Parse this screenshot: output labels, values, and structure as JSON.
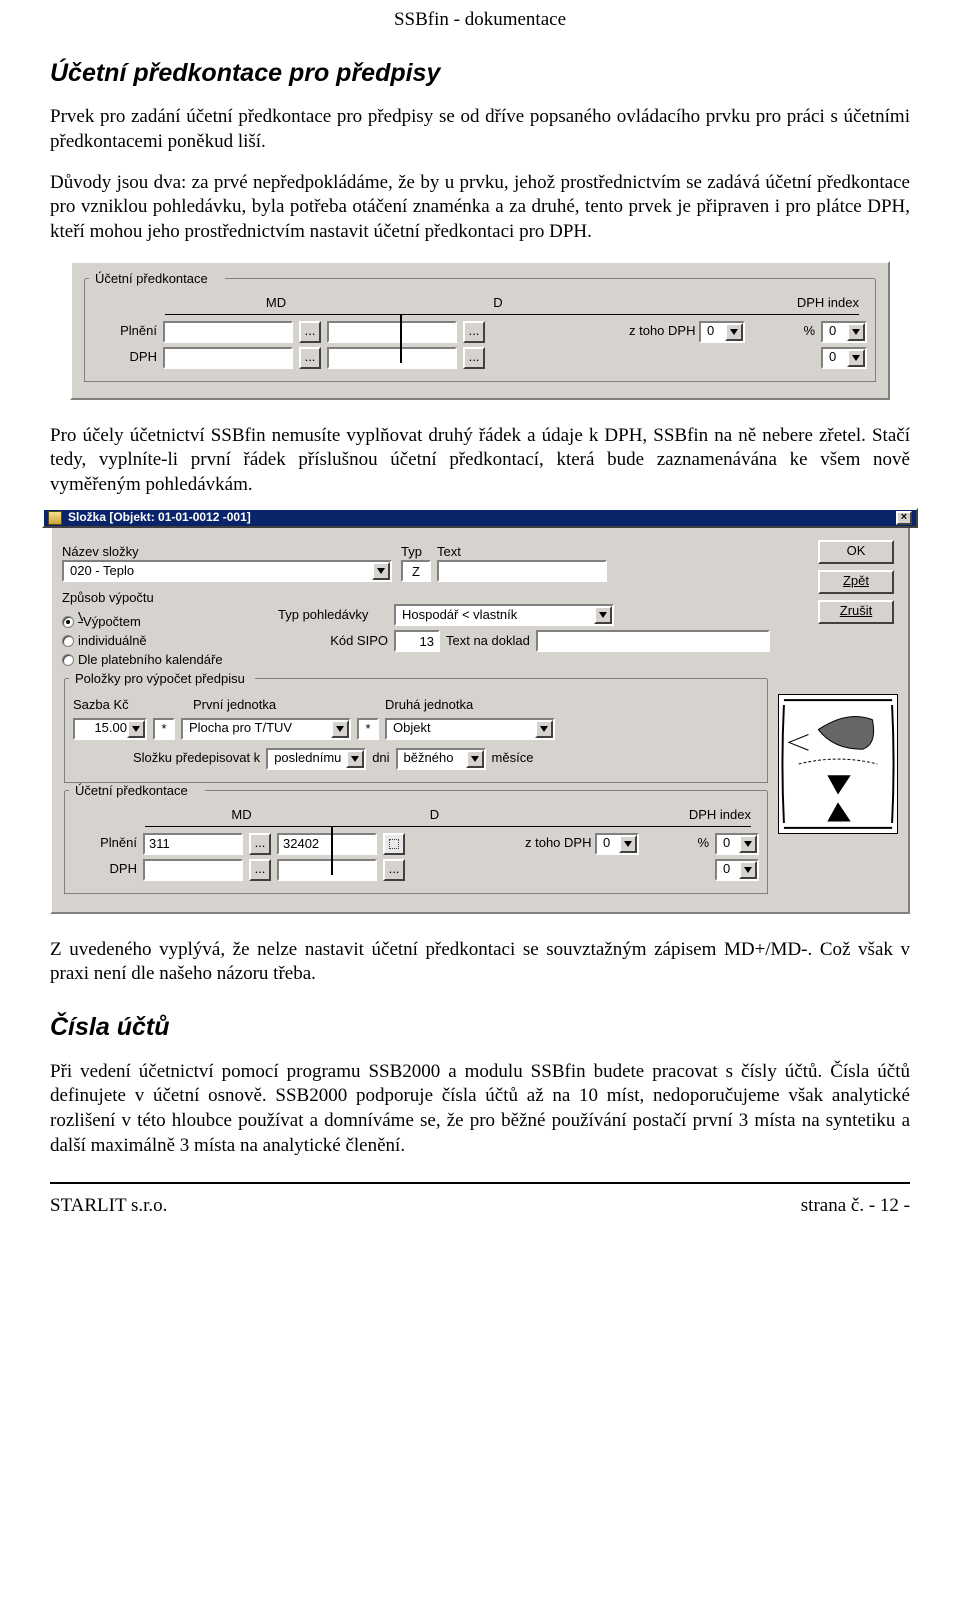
{
  "doc": {
    "header": "SSBfin - dokumentace",
    "section1_title": "Účetní předkontace pro předpisy",
    "para1": "Prvek pro zadání účetní předkontace pro předpisy se od dříve popsaného ovládacího prvku pro práci s účetními předkontacemi poněkud liší.",
    "para2": "Důvody jsou dva: za prvé nepředpokládáme, že by u prvku, jehož prostřednictvím se zadává účetní předkontace pro vzniklou pohledávku, byla potřeba otáčení znaménka a za druhé, tento prvek je připraven i pro plátce DPH, kteří mohou jeho prostřednictvím nastavit účetní předkontaci pro DPH.",
    "para3": "Pro účely účetnictví SSBfin nemusíte vyplňovat druhý řádek a údaje k DPH, SSBfin na ně nebere zřetel. Stačí tedy, vyplníte-li první řádek příslušnou účetní předkontací, která bude zaznamenávána ke všem nově vyměřeným pohledávkám.",
    "para4": "Z uvedeného vyplývá, že nelze nastavit účetní předkontaci se souvztažným zápisem MD+/MD-. Což však v praxi není dle našeho názoru třeba.",
    "section2_title": "Čísla účtů",
    "para5": "Při vedení účetnictví pomocí programu SSB2000 a modulu SSBfin budete pracovat s čísly účtů. Čísla účtů definujete v účetní osnově. SSB2000 podporuje čísla účtů až na 10 míst, nedoporučujeme však analytické rozlišení v této hloubce používat a domníváme se, že pro běžné používání postačí první 3 místa na syntetiku a další maximálně 3 místa na analytické členění.",
    "footer_left": "STARLIT s.r.o.",
    "footer_right": "strana č. - 12 -"
  },
  "pk_panel": {
    "legend": "Účetní předkontace",
    "md": "MD",
    "d": "D",
    "dph_index": "DPH index",
    "plneni": "Plnění",
    "dph": "DPH",
    "dots": "...",
    "z_toho": "z toho DPH",
    "percent": "%",
    "val0": "0"
  },
  "slozka": {
    "title": "Složka  [Objekt: 01-01-0012 -001]",
    "nazev_lbl": "Název složky",
    "nazev_val": "020 - Teplo",
    "typ_lbl": "Typ",
    "typ_val": "Z",
    "text_lbl": "Text",
    "text_val": "",
    "ok": "OK",
    "zpet": "Zpět",
    "zrusit": "Zrušit",
    "zpusob_lbl": "Způsob výpočtu",
    "radio1": "Výpočtem",
    "radio2": "individuálně",
    "radio3": "Dle platebního kalendáře",
    "typ_pohl_lbl": "Typ pohledávky",
    "typ_pohl_val": "Hospodář < vlastník",
    "kod_sipo_lbl": "Kód SIPO",
    "kod_sipo_val": "13",
    "text_doklad_lbl": "Text na doklad",
    "polozky_legend": "Položky pro výpočet předpisu",
    "sazba_lbl": "Sazba Kč",
    "sazba_val": "15.00",
    "star": "*",
    "prvni_lbl": "První jednotka",
    "prvni_val": "Plocha pro T/TUV",
    "druha_lbl": "Druhá jednotka",
    "druha_val": "Objekt",
    "predepisovat_lbl": "Složku předepisovat k",
    "predepisovat_val": "poslednímu",
    "dni": "dni",
    "bezneho": "běžného",
    "mesice": "měsíce",
    "pk_legend": "Účetní předkontace",
    "md_val": "311",
    "d_val": "32402",
    "dph_z": "0",
    "dph_idx": "0",
    "dph2_idx": "0"
  }
}
